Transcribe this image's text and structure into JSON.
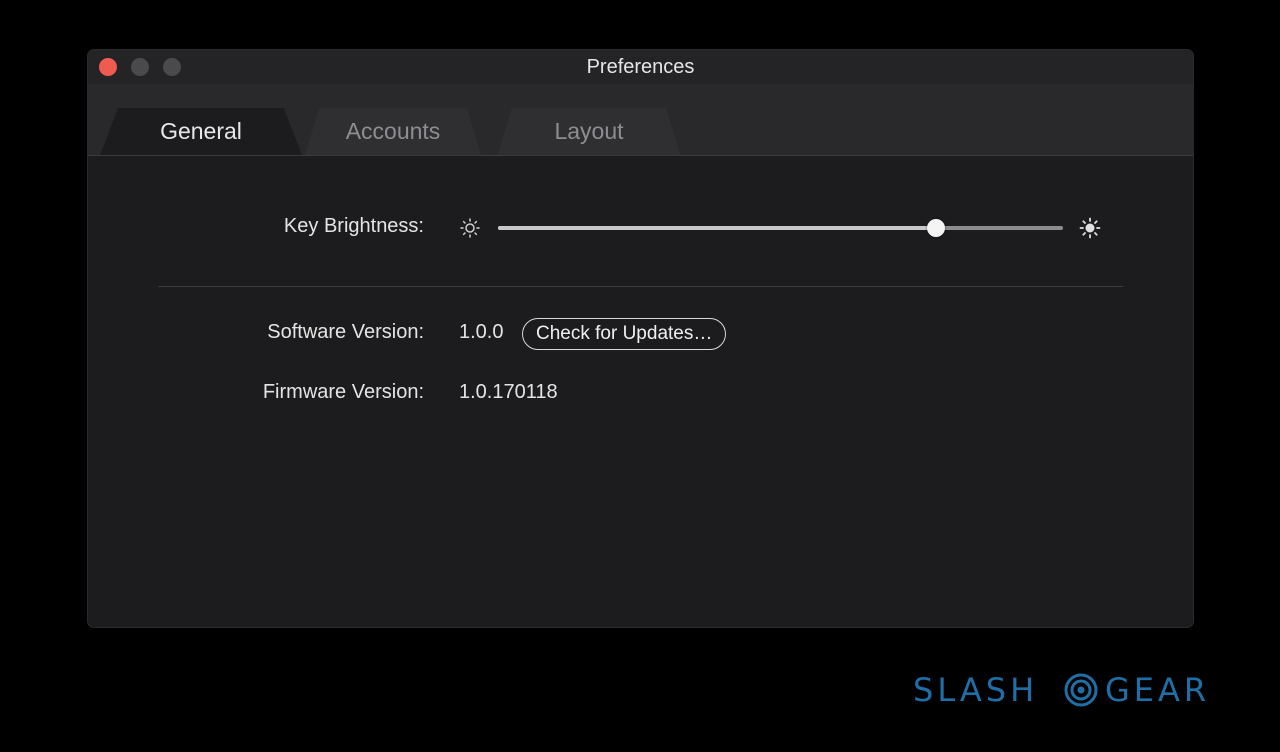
{
  "window": {
    "title": "Preferences"
  },
  "tabs": [
    {
      "label": "General",
      "active": true
    },
    {
      "label": "Accounts",
      "active": false
    },
    {
      "label": "Layout",
      "active": false
    }
  ],
  "general": {
    "brightness_label": "Key Brightness:",
    "brightness_value": 0.775,
    "software_label": "Software Version:",
    "software_value": "1.0.0",
    "check_updates_label": "Check for Updates…",
    "firmware_label": "Firmware Version:",
    "firmware_value": "1.0.170118"
  },
  "icons": {
    "brightness_low": "sun-outline-icon",
    "brightness_high": "sun-filled-icon"
  },
  "colors": {
    "close": "#ee5b51",
    "window_bg": "#1c1c1e",
    "watermark": "#1e6fa8"
  },
  "watermark": {
    "left": "SLASH",
    "right": "GEAR"
  }
}
